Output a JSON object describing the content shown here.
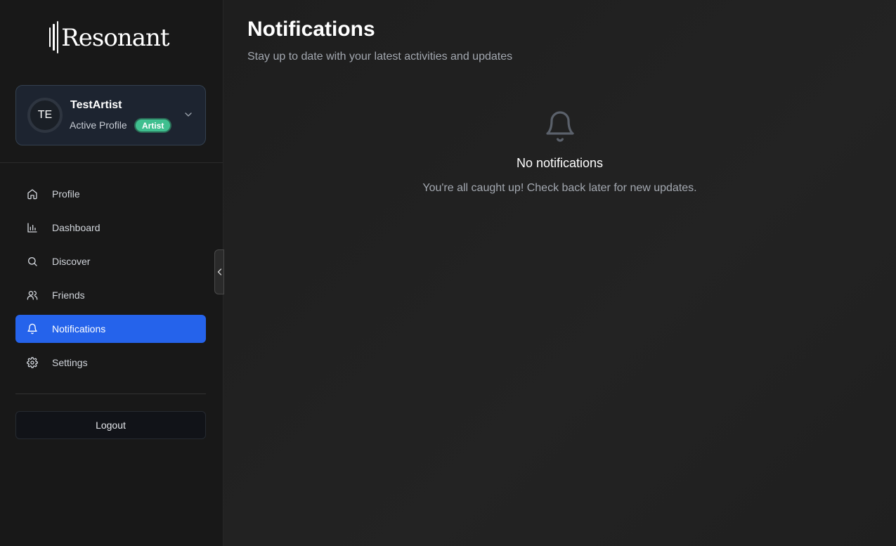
{
  "app": {
    "logo_text": "Resonant"
  },
  "profile": {
    "initials": "TE",
    "name": "TestArtist",
    "subtitle": "Active Profile",
    "badge": "Artist"
  },
  "nav": {
    "items": [
      {
        "label": "Profile",
        "icon": "home-icon"
      },
      {
        "label": "Dashboard",
        "icon": "bar-chart-icon"
      },
      {
        "label": "Discover",
        "icon": "search-icon"
      },
      {
        "label": "Friends",
        "icon": "users-icon"
      },
      {
        "label": "Notifications",
        "icon": "bell-icon",
        "active": true
      },
      {
        "label": "Settings",
        "icon": "gear-icon"
      }
    ],
    "logout_label": "Logout"
  },
  "main": {
    "title": "Notifications",
    "subtitle": "Stay up to date with your latest activities and updates",
    "empty_title": "No notifications",
    "empty_text": "You're all caught up! Check back later for new updates."
  },
  "colors": {
    "accent": "#2563eb",
    "badge": "#3fbf8f",
    "background": "#1c1c1c"
  }
}
